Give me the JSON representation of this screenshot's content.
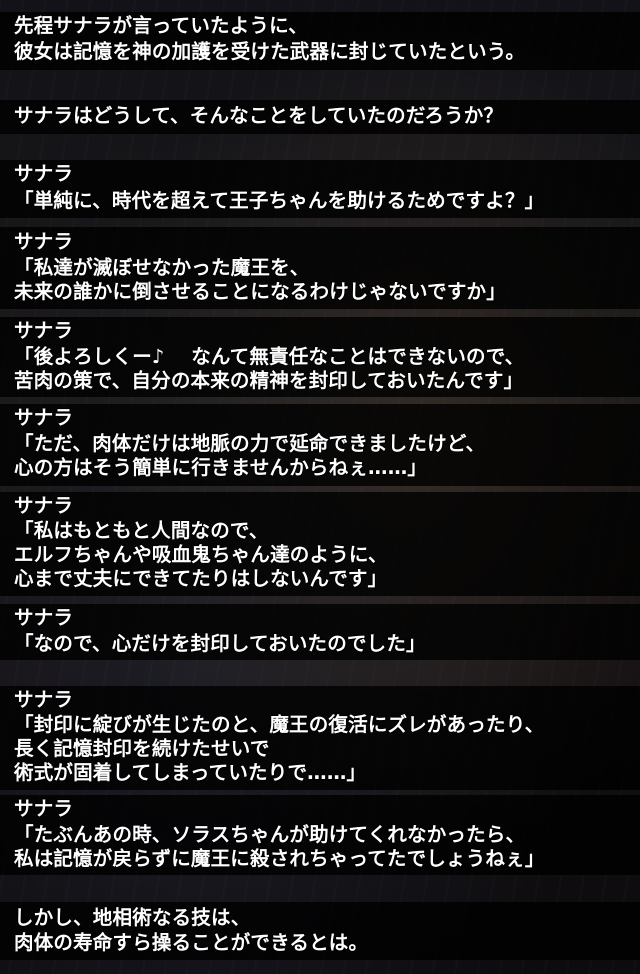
{
  "blocks": [
    {
      "id": "narration-1",
      "lines": [
        "先程サナラが言っていたように、",
        "彼女は記憶を神の加護を受けた武器に封じていたという。"
      ]
    },
    {
      "id": "narration-2",
      "lines": [
        "サナラはどうして、そんなことをしていたのだろうか？"
      ]
    },
    {
      "id": "dialogue-1",
      "lines": [
        "サナラ",
        "「単純に、時代を超えて王子ちゃんを助けるためですよ？」"
      ]
    },
    {
      "id": "dialogue-2",
      "lines": [
        "サナラ",
        "「私達が滅ぼせなかった魔王を、",
        "未来の誰かに倒させることになるわけじゃないですか」"
      ]
    },
    {
      "id": "dialogue-3",
      "lines": [
        "サナラ",
        "「後よろしくー♪　 なんて無責任なことはできないので、",
        "苦肉の策で、自分の本来の精神を封印しておいたんです」"
      ]
    },
    {
      "id": "dialogue-4",
      "lines": [
        "サナラ",
        "「ただ、肉体だけは地脈の力で延命できましたけど、",
        "心の方はそう簡単に行きませんからねぇ……」"
      ]
    },
    {
      "id": "dialogue-5",
      "lines": [
        "サナラ",
        "「私はもともと人間なので、",
        "エルフちゃんや吸血鬼ちゃん達のように、",
        "心まで丈夫にできてたりはしないんです」"
      ]
    },
    {
      "id": "dialogue-6",
      "lines": [
        "サナラ",
        "「なので、心だけを封印しておいたのでした」"
      ]
    },
    {
      "id": "dialogue-7",
      "lines": [
        "サナラ",
        "「封印に綻びが生じたのと、魔王の復活にズレがあったり、",
        "長く記憶封印を続けたせいで",
        "術式が固着してしまっていたりで……」"
      ]
    },
    {
      "id": "dialogue-8",
      "lines": [
        "サナラ",
        "「たぶんあの時、ソラスちゃんが助けてくれなかったら、",
        "私は記憶が戻らずに魔王に殺されちゃってたでしょうねぇ」"
      ]
    },
    {
      "id": "narration-3",
      "lines": [
        "しかし、地相術なる技は、",
        "肉体の寿命すら操ることができるとは。"
      ]
    }
  ]
}
